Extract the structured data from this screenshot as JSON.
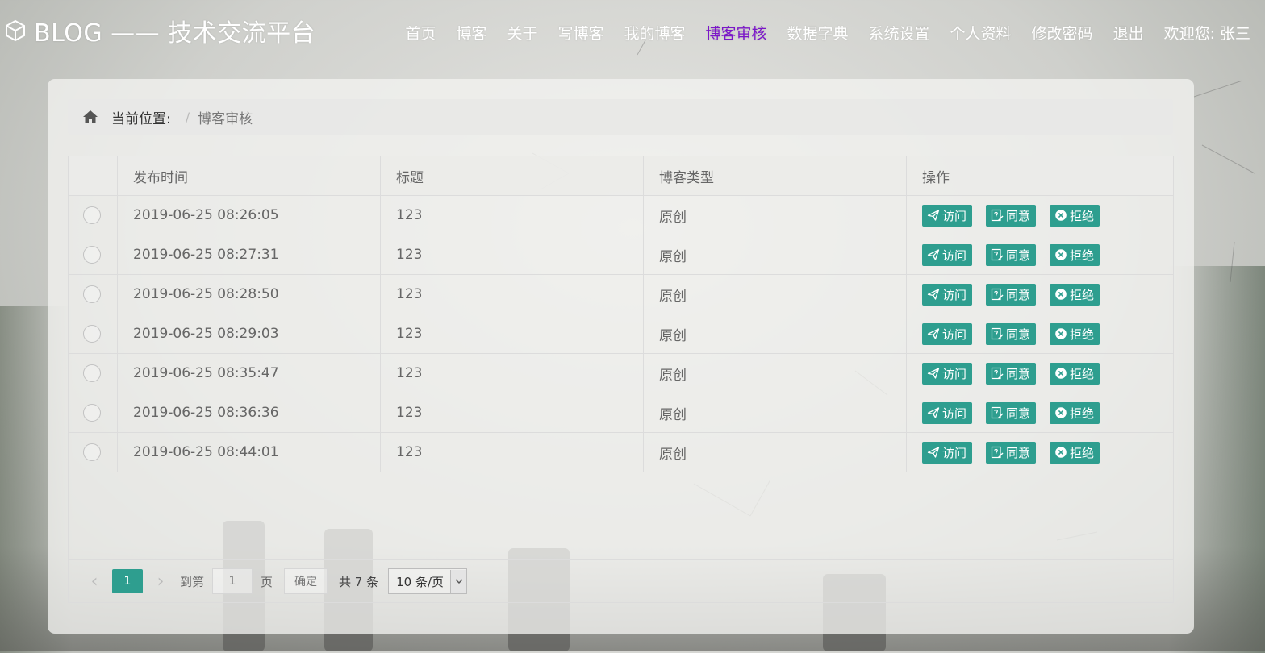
{
  "header": {
    "logo_text": "BLOG —— 技术交流平台",
    "nav": [
      {
        "label": "首页",
        "active": false
      },
      {
        "label": "博客",
        "active": false
      },
      {
        "label": "关于",
        "active": false
      },
      {
        "label": "写博客",
        "active": false
      },
      {
        "label": "我的博客",
        "active": false
      },
      {
        "label": "博客审核",
        "active": true
      },
      {
        "label": "数据字典",
        "active": false
      },
      {
        "label": "系统设置",
        "active": false
      },
      {
        "label": "个人资料",
        "active": false
      },
      {
        "label": "修改密码",
        "active": false
      },
      {
        "label": "退出",
        "active": false
      }
    ],
    "welcome": "欢迎您:",
    "username": "张三"
  },
  "breadcrumb": {
    "label": "当前位置:",
    "separator": "/",
    "current": "博客审核"
  },
  "table": {
    "columns": [
      "",
      "发布时间",
      "标题",
      "博客类型",
      "操作"
    ],
    "rows": [
      {
        "time": "2019-06-25 08:26:05",
        "title": "123",
        "type": "原创"
      },
      {
        "time": "2019-06-25 08:27:31",
        "title": "123",
        "type": "原创"
      },
      {
        "time": "2019-06-25 08:28:50",
        "title": "123",
        "type": "原创"
      },
      {
        "time": "2019-06-25 08:29:03",
        "title": "123",
        "type": "原创"
      },
      {
        "time": "2019-06-25 08:35:47",
        "title": "123",
        "type": "原创"
      },
      {
        "time": "2019-06-25 08:36:36",
        "title": "123",
        "type": "原创"
      },
      {
        "time": "2019-06-25 08:44:01",
        "title": "123",
        "type": "原创"
      }
    ],
    "actions": {
      "visit": "访问",
      "approve": "同意",
      "reject": "拒绝"
    }
  },
  "pager": {
    "prev": "‹",
    "current_page": "1",
    "next": "›",
    "goto_label": "到第",
    "goto_value": "1",
    "page_unit": "页",
    "confirm": "确定",
    "total": "共 7 条",
    "page_size": "10 条/页"
  },
  "colors": {
    "accent": "#2e9e8f",
    "nav_active": "#7b16c9"
  }
}
